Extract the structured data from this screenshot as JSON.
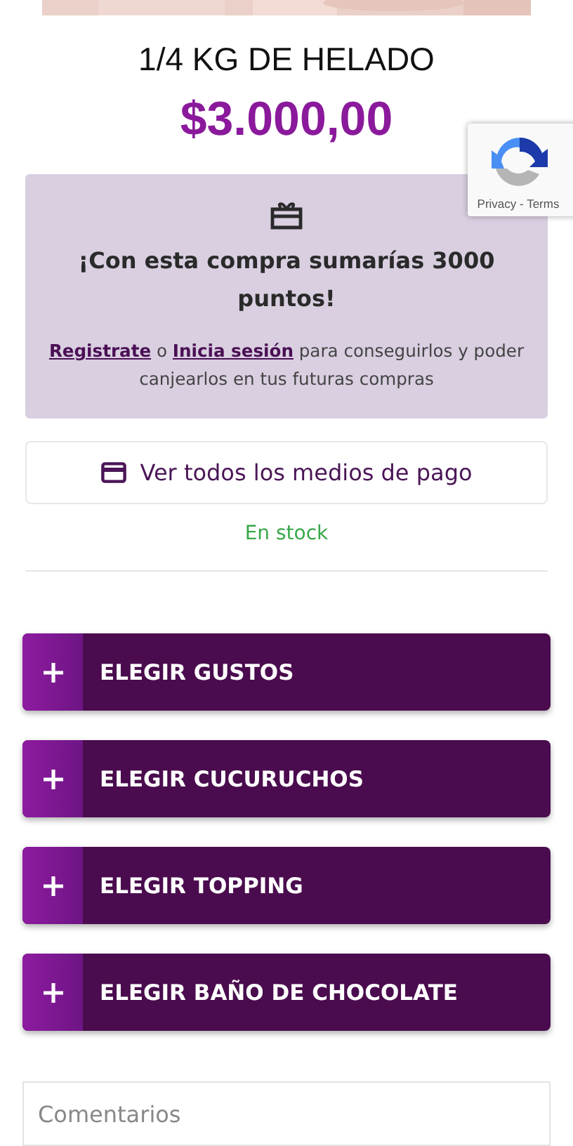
{
  "product": {
    "title": "1/4 KG DE HELADO",
    "price": "$3.000,00"
  },
  "recaptcha": {
    "links": "Privacy - Terms"
  },
  "points": {
    "heading": "¡Con esta compra sumarías 3000 puntos!",
    "register_link": "Registrate",
    "connector": "o",
    "login_link": "Inicia sesión",
    "rest": "para conseguirlos y poder canjearlos en tus futuras compras"
  },
  "payment_button": {
    "label": "Ver todos los medios de pago"
  },
  "stock": "En stock",
  "options": [
    {
      "label": "ELEGIR GUSTOS",
      "expanded": false
    },
    {
      "label": "ELEGIR CUCURUCHOS",
      "expanded": false
    },
    {
      "label": "ELEGIR TOPPING",
      "expanded": false
    },
    {
      "label": "ELEGIR BAÑO DE CHOCOLATE",
      "expanded": false
    }
  ],
  "comments": {
    "placeholder": "Comentarios"
  }
}
